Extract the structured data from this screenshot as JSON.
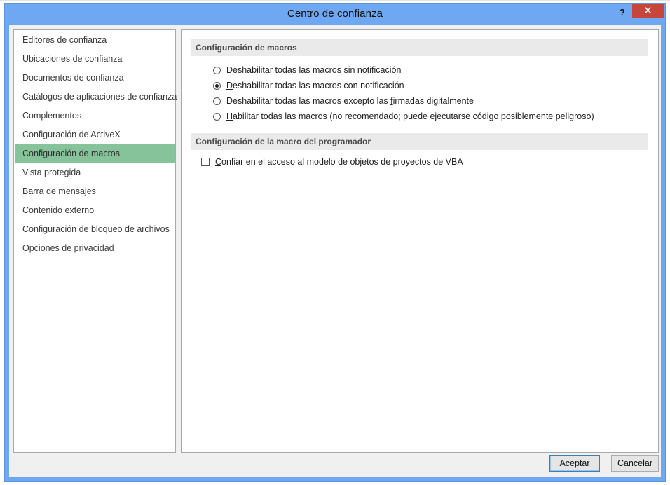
{
  "window": {
    "title": "Centro de confianza",
    "help_label": "?",
    "close_label": "✕"
  },
  "sidebar": {
    "items": [
      {
        "label": "Editores de confianza",
        "active": false
      },
      {
        "label": "Ubicaciones de confianza",
        "active": false
      },
      {
        "label": "Documentos de confianza",
        "active": false
      },
      {
        "label": "Catálogos de aplicaciones de confianza",
        "active": false
      },
      {
        "label": "Complementos",
        "active": false
      },
      {
        "label": "Configuración de ActiveX",
        "active": false
      },
      {
        "label": "Configuración de macros",
        "active": true
      },
      {
        "label": "Vista protegida",
        "active": false
      },
      {
        "label": "Barra de mensajes",
        "active": false
      },
      {
        "label": "Contenido externo",
        "active": false
      },
      {
        "label": "Configuración de bloqueo de archivos",
        "active": false
      },
      {
        "label": "Opciones de privacidad",
        "active": false
      }
    ]
  },
  "macros": {
    "header": "Configuración de macros",
    "options": [
      {
        "pre": "Deshabilitar todas las ",
        "key": "m",
        "post": "acros sin notificación",
        "checked": false
      },
      {
        "pre": "",
        "key": "D",
        "post": "eshabilitar todas las macros con notificación",
        "checked": true
      },
      {
        "pre": "Deshabilitar todas las macros excepto las ",
        "key": "f",
        "post": "irmadas digitalmente",
        "checked": false
      },
      {
        "pre": "",
        "key": "H",
        "post": "abilitar todas las macros (no recomendado; puede ejecutarse código posiblemente peligroso)",
        "checked": false
      }
    ]
  },
  "developer": {
    "header": "Configuración de la macro del programador",
    "checkbox": {
      "pre": "",
      "key": "C",
      "post": "onfiar en el acceso al modelo de objetos de proyectos de VBA",
      "checked": false
    }
  },
  "buttons": {
    "ok": "Aceptar",
    "cancel": "Cancelar"
  },
  "colors": {
    "titlebar": "#6fa8f2",
    "close": "#c7463b",
    "active_nav": "#86c29a"
  }
}
